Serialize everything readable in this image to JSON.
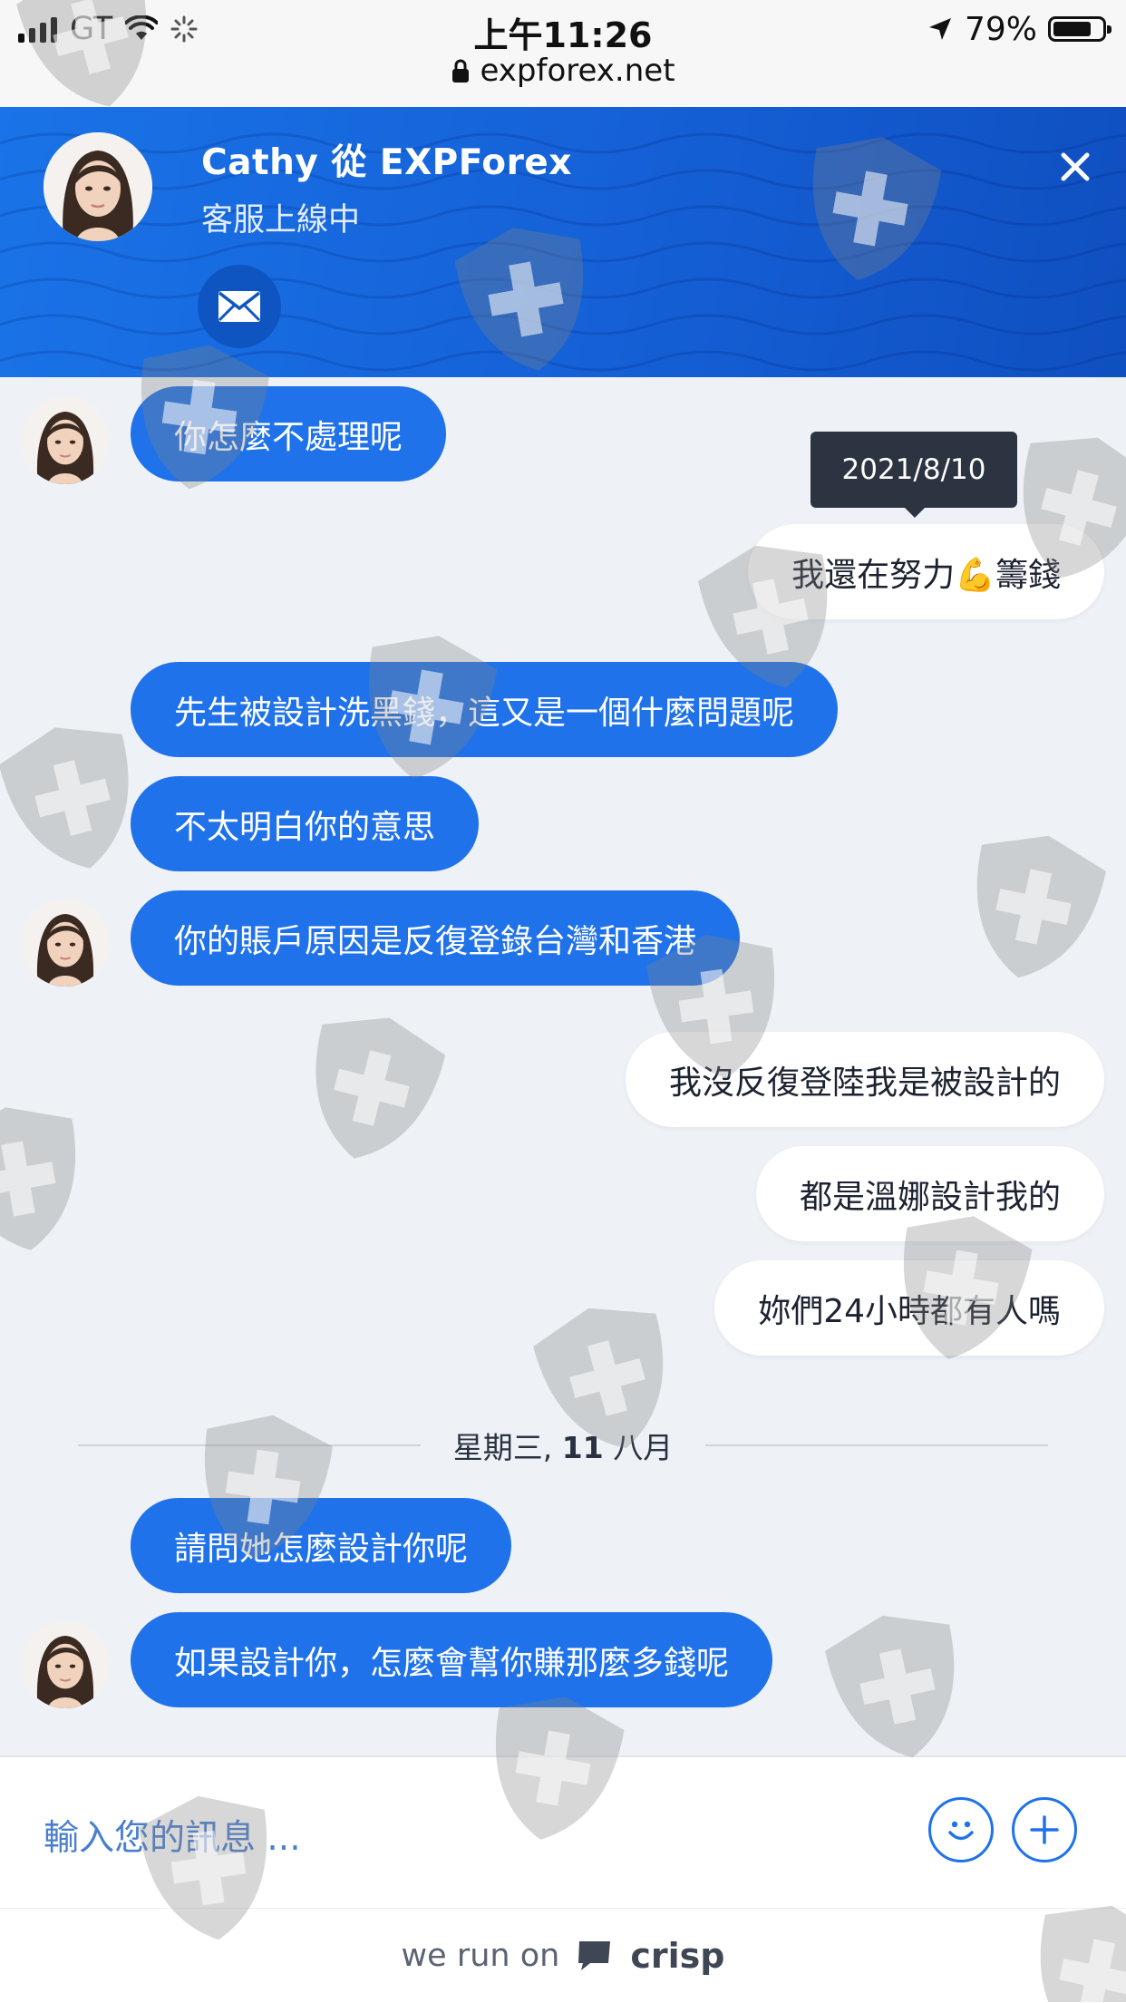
{
  "status_bar": {
    "carrier": "GT",
    "time": "上午11:26",
    "battery": "79%",
    "battery_level": 0.79,
    "url": "expforex.net"
  },
  "header": {
    "agent_name": "Cathy 從 EXPForex",
    "agent_status": "客服上線中"
  },
  "tooltip": "2021/8/10",
  "messages": [
    {
      "from": "operator",
      "text": "你怎麼不處理呢"
    },
    {
      "from": "user",
      "text": "我還在努力💪籌錢"
    },
    {
      "from": "operator",
      "text": "先生被設計洗黑錢，這又是一個什麼問題呢"
    },
    {
      "from": "operator",
      "text": "不太明白你的意思"
    },
    {
      "from": "operator",
      "text": "你的賬戶原因是反復登錄台灣和香港"
    },
    {
      "from": "user",
      "text": "我沒反復登陸我是被設計的"
    },
    {
      "from": "user",
      "text": "都是溫娜設計我的"
    },
    {
      "from": "user",
      "text": "妳們24小時都有人嗎"
    },
    {
      "from": "operator",
      "text": "請問她怎麼設計你呢"
    },
    {
      "from": "operator",
      "text": "如果設計你，怎麼會幫你賺那麼多錢呢"
    }
  ],
  "date_separator": {
    "prefix": "星期三,",
    "day": "11",
    "month": "八月"
  },
  "composer": {
    "placeholder": "輸入您的訊息 ..."
  },
  "footer": {
    "prefix": "we run on",
    "brand": "crisp"
  },
  "icons": {
    "mail": "envelope-icon",
    "close": "close-icon",
    "emoji": "smiley-icon",
    "attach": "plus-icon",
    "lock": "lock-icon"
  },
  "colors": {
    "accent": "#1f72ea",
    "header": "#1565d8",
    "background": "#eef2f7"
  }
}
